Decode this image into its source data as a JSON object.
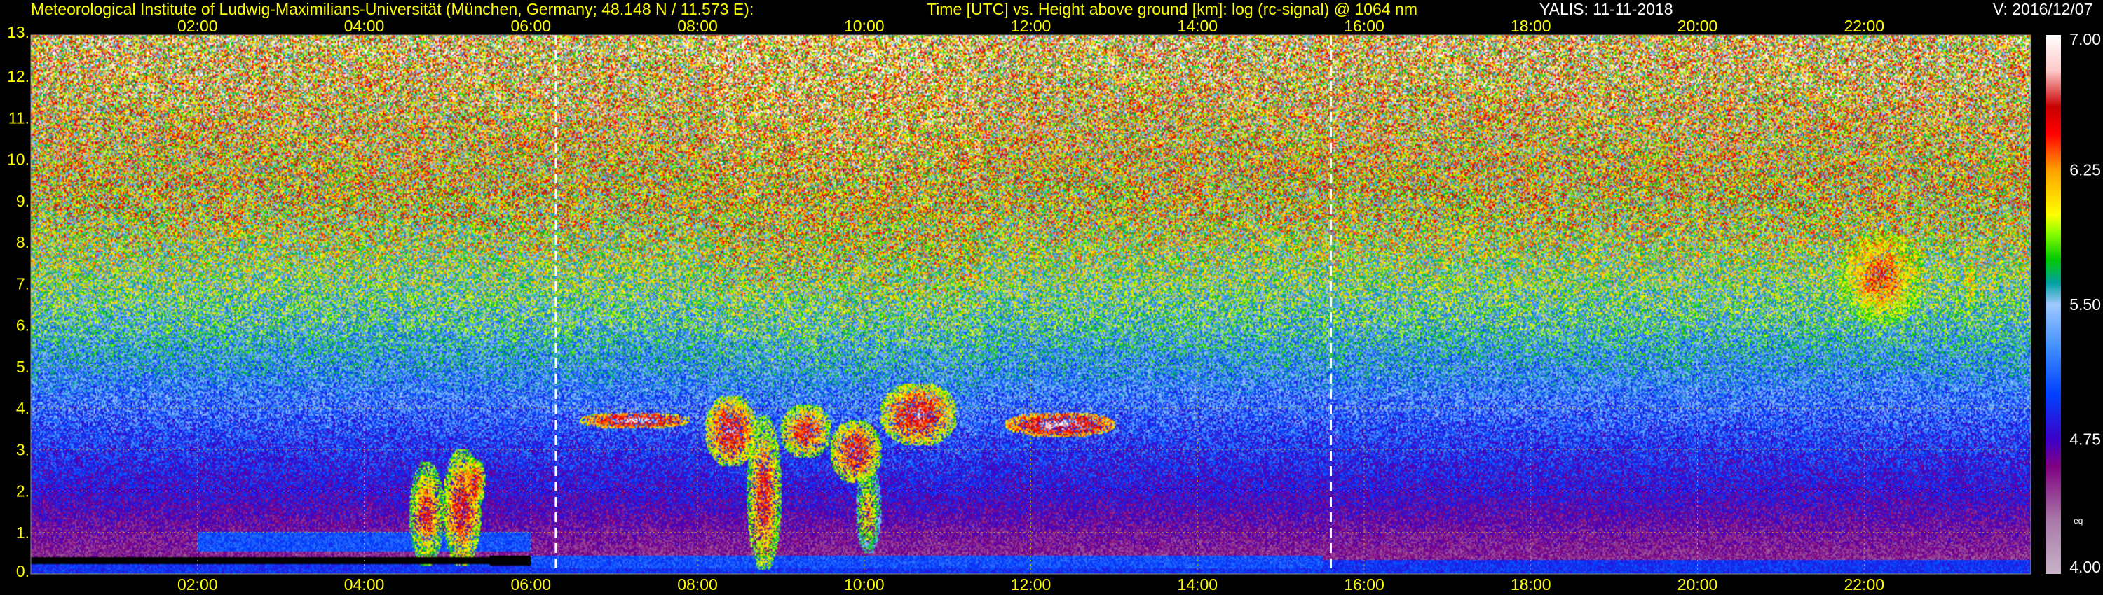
{
  "header": {
    "institution": "Meteorological Institute of Ludwig-Maximilians-Universität (München, Germany; 48.148 N / 11.573 E):",
    "axes_description": "Time [UTC] vs. Height above ground [km]: log (rc-signal) @ 1064 nm",
    "instrument_date": "YALIS: 11-11-2018",
    "version": "V: 2016/12/07"
  },
  "colors": {
    "header_text": "#ffff00",
    "tick_text": "#ffff00",
    "grid": "#c8c800",
    "background": "#000000",
    "marker_line": "#ffffff"
  },
  "chart_data": {
    "type": "heatmap",
    "title": "Time [UTC] vs. Height above ground [km]: log (rc-signal) @ 1064 nm",
    "xlabel": "Time [UTC]",
    "ylabel": "Height above ground [km]",
    "x_unit": "hours UTC",
    "xlim": [
      0,
      24
    ],
    "ylim": [
      0,
      13
    ],
    "x_ticks": [
      {
        "value": 2,
        "label": "02:00"
      },
      {
        "value": 4,
        "label": "04:00"
      },
      {
        "value": 6,
        "label": "06:00"
      },
      {
        "value": 8,
        "label": "08:00"
      },
      {
        "value": 10,
        "label": "10:00"
      },
      {
        "value": 12,
        "label": "12:00"
      },
      {
        "value": 14,
        "label": "14:00"
      },
      {
        "value": 16,
        "label": "16:00"
      },
      {
        "value": 18,
        "label": "18:00"
      },
      {
        "value": 20,
        "label": "20:00"
      },
      {
        "value": 22,
        "label": "22:00"
      }
    ],
    "y_ticks": [
      {
        "value": 0,
        "label": "0."
      },
      {
        "value": 1,
        "label": "1."
      },
      {
        "value": 2,
        "label": "2."
      },
      {
        "value": 3,
        "label": "3."
      },
      {
        "value": 4,
        "label": "4."
      },
      {
        "value": 5,
        "label": "5."
      },
      {
        "value": 6,
        "label": "6."
      },
      {
        "value": 7,
        "label": "7."
      },
      {
        "value": 8,
        "label": "8."
      },
      {
        "value": 9,
        "label": "9."
      },
      {
        "value": 10,
        "label": "10."
      },
      {
        "value": 11,
        "label": "11."
      },
      {
        "value": 12,
        "label": "12."
      },
      {
        "value": 13,
        "label": "13."
      }
    ],
    "grid": true,
    "grid_style": "dotted",
    "marker_lines": [
      6.3,
      15.6
    ],
    "colorbar": {
      "position": "right",
      "min": 4.0,
      "max": 7.0,
      "ticks": [
        {
          "value": 4.0,
          "label": "4.00"
        },
        {
          "value": 4.75,
          "label": "4.75"
        },
        {
          "value": 5.5,
          "label": "5.50"
        },
        {
          "value": 6.25,
          "label": "6.25"
        },
        {
          "value": 7.0,
          "label": "7.00"
        }
      ],
      "small_label": "eq",
      "stops": [
        {
          "value": 4.0,
          "color": "#c8b4c8"
        },
        {
          "value": 4.3,
          "color": "#a878a8"
        },
        {
          "value": 4.6,
          "color": "#800080"
        },
        {
          "value": 4.75,
          "color": "#3c00c8"
        },
        {
          "value": 5.0,
          "color": "#0040ff"
        },
        {
          "value": 5.25,
          "color": "#3c8cff"
        },
        {
          "value": 5.5,
          "color": "#a0c8ff"
        },
        {
          "value": 5.62,
          "color": "#00a0a0"
        },
        {
          "value": 5.75,
          "color": "#00c800"
        },
        {
          "value": 5.9,
          "color": "#90ff00"
        },
        {
          "value": 6.0,
          "color": "#ffff00"
        },
        {
          "value": 6.25,
          "color": "#ffa000"
        },
        {
          "value": 6.45,
          "color": "#ff0000"
        },
        {
          "value": 6.6,
          "color": "#c80000"
        },
        {
          "value": 6.8,
          "color": "#ffc8c8"
        },
        {
          "value": 7.0,
          "color": "#ffffff"
        }
      ]
    },
    "field": {
      "background_by_height": [
        {
          "height": 0.0,
          "value": 4.45
        },
        {
          "height": 0.3,
          "value": 4.5
        },
        {
          "height": 1.0,
          "value": 4.6
        },
        {
          "height": 2.0,
          "value": 4.8
        },
        {
          "height": 3.0,
          "value": 4.95
        },
        {
          "height": 4.0,
          "value": 5.15
        },
        {
          "height": 5.0,
          "value": 5.35
        },
        {
          "height": 6.0,
          "value": 5.55
        },
        {
          "height": 7.0,
          "value": 5.72
        },
        {
          "height": 8.0,
          "value": 5.85
        },
        {
          "height": 9.0,
          "value": 5.95
        },
        {
          "height": 10.0,
          "value": 6.05
        },
        {
          "height": 11.0,
          "value": 6.12
        },
        {
          "height": 12.0,
          "value": 6.2
        },
        {
          "height": 13.0,
          "value": 6.25
        }
      ],
      "noisy_periods": [
        {
          "x0": 8.2,
          "x1": 11.4,
          "boost": 0.35
        }
      ],
      "boundary_layer": [
        {
          "x0": 0.0,
          "x1": 24.0,
          "y0": 0.0,
          "y1": 0.35,
          "value": 4.95
        },
        {
          "x0": 6.0,
          "x1": 15.5,
          "y0": 0.15,
          "y1": 0.45,
          "value": 5.05
        },
        {
          "x0": 2.0,
          "x1": 6.0,
          "y0": 0.55,
          "y1": 1.0,
          "value": 5.05
        }
      ],
      "clouds": [
        {
          "x0": 4.55,
          "x1": 4.95,
          "y0": 0.2,
          "y1": 2.7,
          "value": 6.55
        },
        {
          "x0": 4.95,
          "x1": 5.4,
          "y0": 0.2,
          "y1": 3.0,
          "value": 6.65
        },
        {
          "x0": 5.2,
          "x1": 5.45,
          "y0": 1.6,
          "y1": 2.8,
          "value": 6.7
        },
        {
          "x0": 6.6,
          "x1": 7.9,
          "y0": 3.5,
          "y1": 3.9,
          "value": 6.9
        },
        {
          "x0": 8.1,
          "x1": 8.7,
          "y0": 2.6,
          "y1": 4.3,
          "value": 6.75
        },
        {
          "x0": 8.6,
          "x1": 9.0,
          "y0": 0.1,
          "y1": 3.8,
          "value": 6.6
        },
        {
          "x0": 9.0,
          "x1": 9.6,
          "y0": 2.8,
          "y1": 4.1,
          "value": 6.65
        },
        {
          "x0": 9.6,
          "x1": 10.2,
          "y0": 2.2,
          "y1": 3.7,
          "value": 6.7
        },
        {
          "x0": 9.9,
          "x1": 10.2,
          "y0": 0.5,
          "y1": 2.6,
          "value": 6.3
        },
        {
          "x0": 10.2,
          "x1": 11.1,
          "y0": 3.1,
          "y1": 4.6,
          "value": 6.75
        },
        {
          "x0": 11.7,
          "x1": 13.0,
          "y0": 3.3,
          "y1": 3.9,
          "value": 6.95
        },
        {
          "x0": 21.7,
          "x1": 22.7,
          "y0": 6.0,
          "y1": 8.3,
          "value": 6.55
        },
        {
          "x0": 23.2,
          "x1": 23.35,
          "y0": 6.3,
          "y1": 7.6,
          "value": 6.4
        }
      ],
      "no_data": [
        {
          "x0": 0.0,
          "x1": 6.0,
          "y0": 0.25,
          "y1": 0.4
        },
        {
          "x0": 5.5,
          "x1": 6.0,
          "y0": 0.2,
          "y1": 0.45
        }
      ]
    }
  }
}
